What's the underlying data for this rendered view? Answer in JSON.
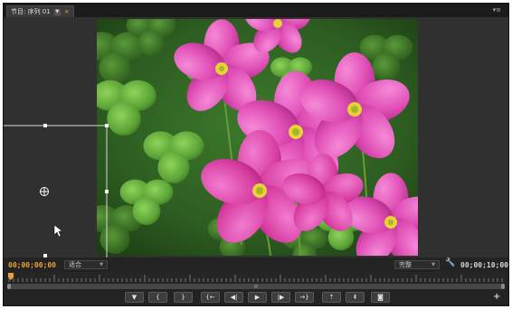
{
  "tab": {
    "label": "节目: 序列 01",
    "close_glyph": "×"
  },
  "panel_menu_glyph": "▾≡",
  "timecodes": {
    "current": "00;00;00;00",
    "duration": "00;00;10;00"
  },
  "zoom_select": {
    "value": "适合"
  },
  "resolution_select": {
    "value": "完整"
  },
  "transport": {
    "buttons": [
      {
        "id": "add-marker",
        "glyph": "▼"
      },
      {
        "id": "mark-in",
        "glyph": "{"
      },
      {
        "id": "mark-out",
        "glyph": "}"
      },
      {
        "id": "go-to-in",
        "glyph": "{←"
      },
      {
        "id": "step-back",
        "glyph": "◀|"
      },
      {
        "id": "play",
        "glyph": "▶"
      },
      {
        "id": "step-forward",
        "glyph": "|▶"
      },
      {
        "id": "go-to-out",
        "glyph": "→}"
      },
      {
        "id": "lift",
        "glyph": "⇡"
      },
      {
        "id": "extract",
        "glyph": "⇞"
      },
      {
        "id": "export-frame",
        "glyph": "◙"
      }
    ]
  },
  "add_button": {
    "glyph": "+"
  },
  "colors": {
    "timecode": "#e8a13a",
    "playhead": "#e8a13a",
    "panel": "#232323",
    "monitor_bg": "#303030"
  }
}
